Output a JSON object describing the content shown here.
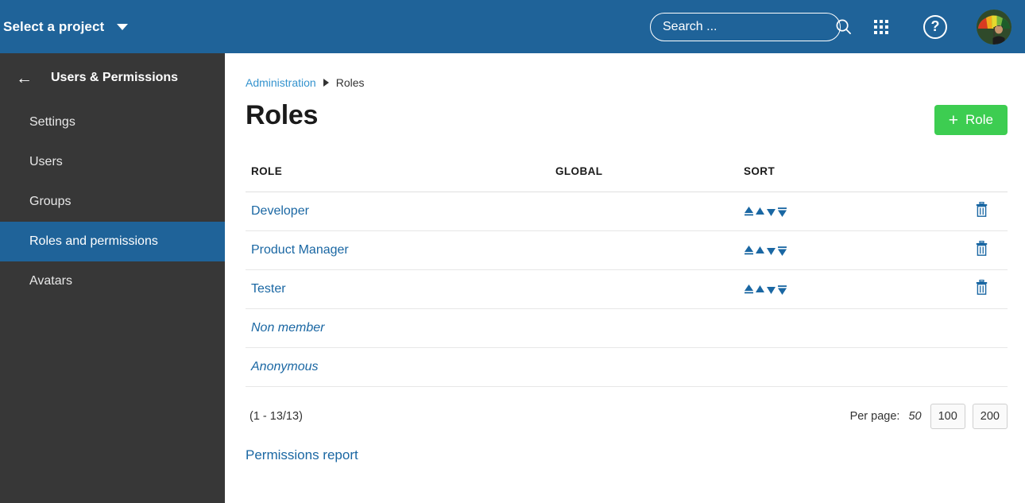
{
  "topbar": {
    "project_selector_label": "Select a project",
    "search_placeholder": "Search ...",
    "search_value": "",
    "help_glyph": "?",
    "icons": {
      "caret": "chevron-down-icon",
      "search": "search-icon",
      "apps": "grid-apps-icon",
      "help": "help-circle-icon",
      "avatar": "user-avatar"
    }
  },
  "sidebar": {
    "back_label": "←",
    "title": "Users & Permissions",
    "items": [
      {
        "label": "Settings",
        "active": false
      },
      {
        "label": "Users",
        "active": false
      },
      {
        "label": "Groups",
        "active": false
      },
      {
        "label": "Roles and permissions",
        "active": true
      },
      {
        "label": "Avatars",
        "active": false
      }
    ]
  },
  "breadcrumb": {
    "parent": "Administration",
    "current": "Roles"
  },
  "page": {
    "title": "Roles",
    "add_button_plus": "+",
    "add_button_label": "Role"
  },
  "table": {
    "headers": {
      "role": "ROLE",
      "global": "GLOBAL",
      "sort": "SORT"
    },
    "rows": [
      {
        "role": "Developer",
        "global": "",
        "sortable": true,
        "deletable": true,
        "italic": false
      },
      {
        "role": "Product Manager",
        "global": "",
        "sortable": true,
        "deletable": true,
        "italic": false
      },
      {
        "role": "Tester",
        "global": "",
        "sortable": true,
        "deletable": true,
        "italic": false
      },
      {
        "role": "Non member",
        "global": "",
        "sortable": false,
        "deletable": false,
        "italic": true
      },
      {
        "role": "Anonymous",
        "global": "",
        "sortable": false,
        "deletable": false,
        "italic": true
      }
    ],
    "sort_actions": [
      "move-to-top-icon",
      "move-up-icon",
      "move-down-icon",
      "move-to-bottom-icon"
    ],
    "delete_icon": "trash-icon"
  },
  "pagination": {
    "count_text": "(1 - 13/13)",
    "per_page_label": "Per page:",
    "options": [
      {
        "value": "50",
        "current": true
      },
      {
        "value": "100",
        "current": false
      },
      {
        "value": "200",
        "current": false
      }
    ]
  },
  "footer": {
    "permissions_report_label": "Permissions report"
  },
  "colors": {
    "topbar_blue": "#1f6399",
    "sidebar_dark": "#373737",
    "accent_blue": "#1a67a3",
    "link_blue": "#3493ce",
    "button_green": "#3dcd51"
  }
}
